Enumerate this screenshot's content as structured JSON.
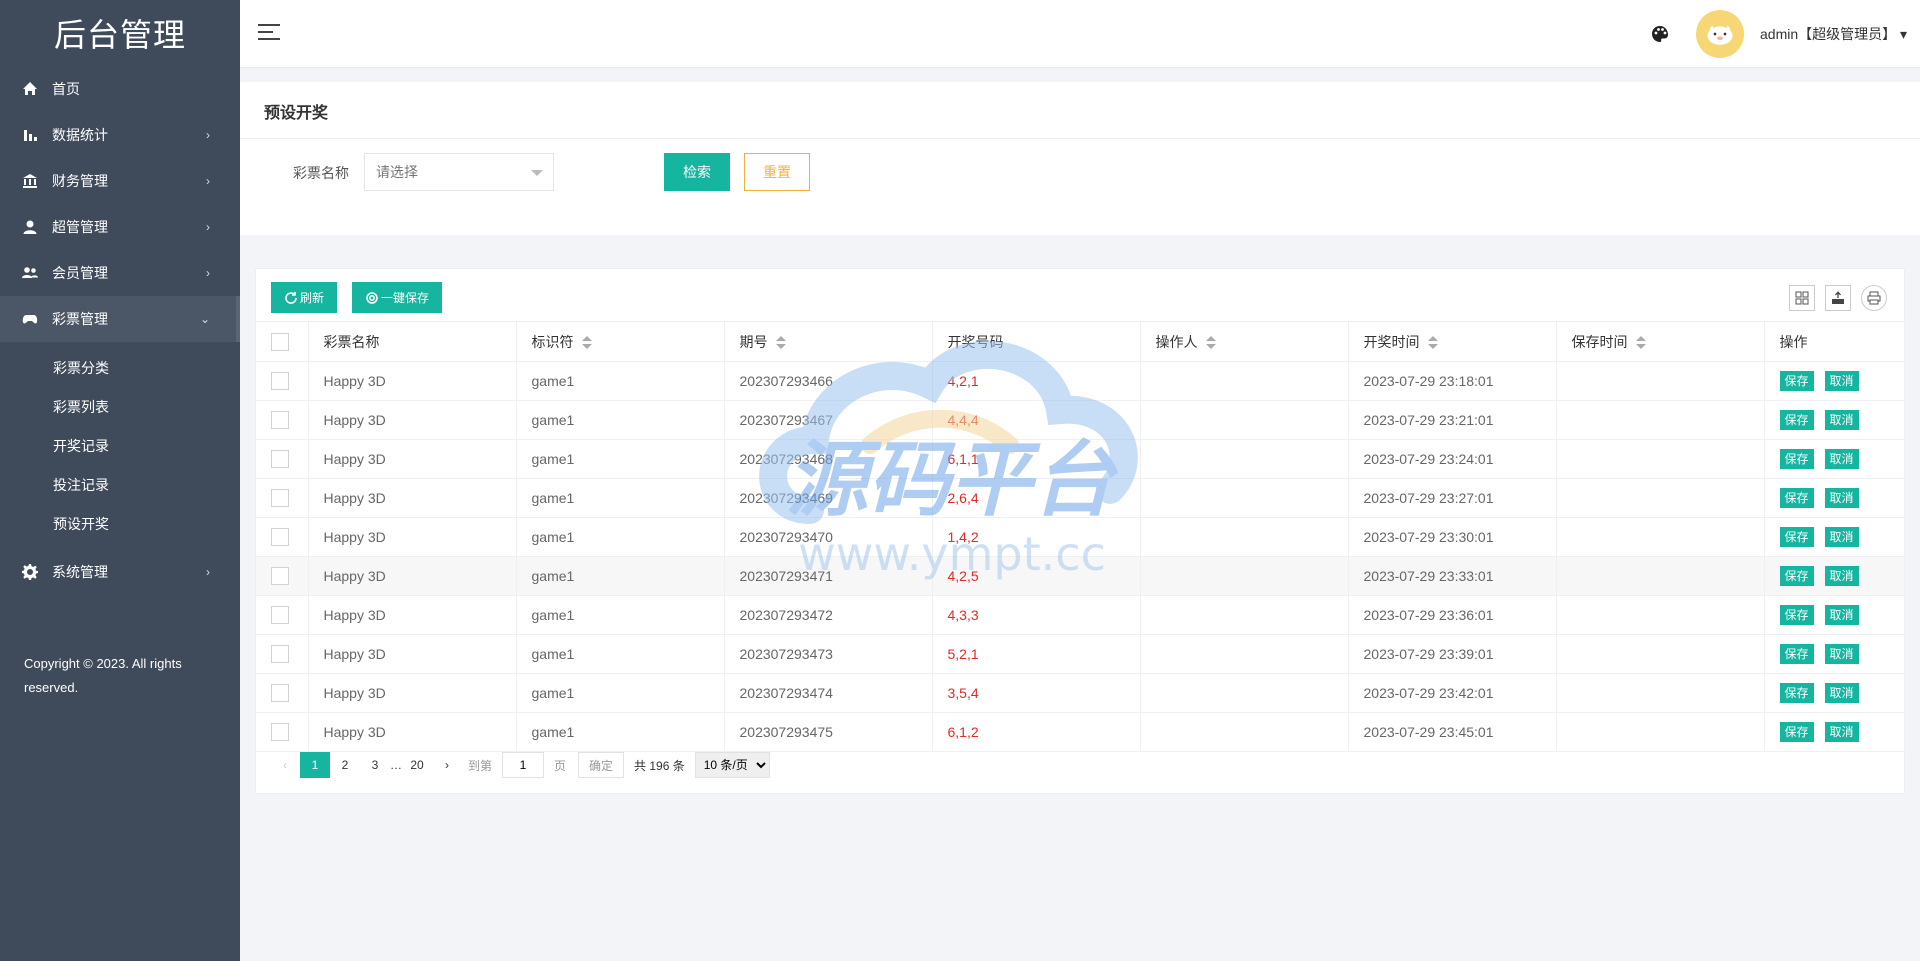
{
  "brand": "后台管理",
  "sidebar": {
    "items": [
      {
        "label": "首页",
        "icon": "home-icon"
      },
      {
        "label": "数据统计",
        "icon": "bar-chart-icon"
      },
      {
        "label": "财务管理",
        "icon": "bank-icon"
      },
      {
        "label": "超管管理",
        "icon": "user-icon"
      },
      {
        "label": "会员管理",
        "icon": "users-icon"
      },
      {
        "label": "彩票管理",
        "icon": "gamepad-icon"
      },
      {
        "label": "系统管理",
        "icon": "gear-icon"
      }
    ],
    "submenu": [
      "彩票分类",
      "彩票列表",
      "开奖记录",
      "投注记录",
      "预设开奖"
    ],
    "copyright": "Copyright © 2023. All rights reserved."
  },
  "header": {
    "user": "admin【超级管理员】"
  },
  "search": {
    "title": "预设开奖",
    "field_label": "彩票名称",
    "placeholder": "请选择",
    "search_btn": "检索",
    "reset_btn": "重置"
  },
  "toolbar": {
    "refresh": "刷新",
    "save_all": "一键保存"
  },
  "table": {
    "columns": [
      "彩票名称",
      "标识符",
      "期号",
      "开奖号码",
      "操作人",
      "开奖时间",
      "保存时间",
      "操作"
    ],
    "save_label": "保存",
    "cancel_label": "取消",
    "rows": [
      {
        "name": "Happy 3D",
        "code": "game1",
        "issue": "202307293466",
        "numbers": "4,2,1",
        "operator": "",
        "time": "2023-07-29 23:18:01",
        "saved": ""
      },
      {
        "name": "Happy 3D",
        "code": "game1",
        "issue": "202307293467",
        "numbers": "4,4,4",
        "operator": "",
        "time": "2023-07-29 23:21:01",
        "saved": ""
      },
      {
        "name": "Happy 3D",
        "code": "game1",
        "issue": "202307293468",
        "numbers": "6,1,1",
        "operator": "",
        "time": "2023-07-29 23:24:01",
        "saved": ""
      },
      {
        "name": "Happy 3D",
        "code": "game1",
        "issue": "202307293469",
        "numbers": "2,6,4",
        "operator": "",
        "time": "2023-07-29 23:27:01",
        "saved": ""
      },
      {
        "name": "Happy 3D",
        "code": "game1",
        "issue": "202307293470",
        "numbers": "1,4,2",
        "operator": "",
        "time": "2023-07-29 23:30:01",
        "saved": ""
      },
      {
        "name": "Happy 3D",
        "code": "game1",
        "issue": "202307293471",
        "numbers": "4,2,5",
        "operator": "",
        "time": "2023-07-29 23:33:01",
        "saved": ""
      },
      {
        "name": "Happy 3D",
        "code": "game1",
        "issue": "202307293472",
        "numbers": "4,3,3",
        "operator": "",
        "time": "2023-07-29 23:36:01",
        "saved": ""
      },
      {
        "name": "Happy 3D",
        "code": "game1",
        "issue": "202307293473",
        "numbers": "5,2,1",
        "operator": "",
        "time": "2023-07-29 23:39:01",
        "saved": ""
      },
      {
        "name": "Happy 3D",
        "code": "game1",
        "issue": "202307293474",
        "numbers": "3,5,4",
        "operator": "",
        "time": "2023-07-29 23:42:01",
        "saved": ""
      },
      {
        "name": "Happy 3D",
        "code": "game1",
        "issue": "202307293475",
        "numbers": "6,1,2",
        "operator": "",
        "time": "2023-07-29 23:45:01",
        "saved": ""
      }
    ]
  },
  "pager": {
    "pages": [
      "1",
      "2",
      "3"
    ],
    "ellipsis": "…",
    "last": "20",
    "goto_label": "到第",
    "current_input": "1",
    "page_unit": "页",
    "confirm": "确定",
    "total": "共 196 条",
    "page_size": "10 条/页"
  },
  "watermark": {
    "text": "源码平台",
    "url": "www.ympt.cc"
  },
  "colors": {
    "sidebar_bg": "#3f4a5a",
    "accent": "#16b5a0",
    "warning": "#f4b03d",
    "number_red": "#e02a2a"
  }
}
